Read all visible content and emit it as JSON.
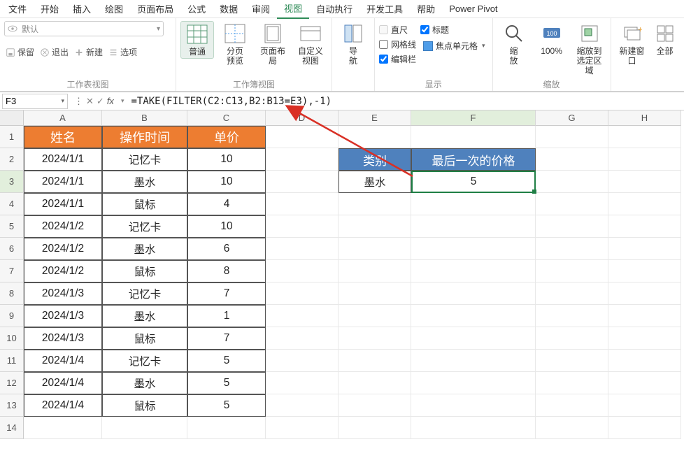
{
  "menu": {
    "items": [
      "文件",
      "开始",
      "插入",
      "绘图",
      "页面布局",
      "公式",
      "数据",
      "审阅",
      "视图",
      "自动执行",
      "开发工具",
      "帮助",
      "Power Pivot"
    ],
    "active_index": 8
  },
  "ribbon": {
    "worksheet_view": {
      "label": "工作表视图",
      "dropdown_text": "默认",
      "save": "保留",
      "exit": "退出",
      "new": "新建",
      "options": "选项"
    },
    "workbook_view": {
      "label": "工作簿视图",
      "normal": "普通",
      "page_break": "分页\n预览",
      "page_layout": "页面布局",
      "custom_view": "自定义视图"
    },
    "nav": {
      "label": "导\n航"
    },
    "display": {
      "label": "显示",
      "ruler": "直尺",
      "gridlines": "网格线",
      "formula_bar": "编辑栏",
      "headings": "标题",
      "focus_cell": "焦点单元格"
    },
    "zoom": {
      "label": "缩放",
      "zoom": "缩\n放",
      "hundred": "100%",
      "to_selection": "缩放到\n选定区域"
    },
    "window": {
      "new_window": "新建窗口",
      "arrange_all": "全部"
    }
  },
  "formula_bar": {
    "name_box": "F3",
    "fx_label": "fx",
    "formula": "=TAKE(FILTER(C2:C13,B2:B13=E3),-1)"
  },
  "grid": {
    "col_letters": [
      "A",
      "B",
      "C",
      "D",
      "E",
      "F",
      "G",
      "H"
    ],
    "row_numbers": [
      1,
      2,
      3,
      4,
      5,
      6,
      7,
      8,
      9,
      10,
      11,
      12,
      13,
      14
    ],
    "headers1": {
      "A": "姓名",
      "B": "操作时间",
      "C": "单价"
    },
    "headers2": {
      "E": "类别",
      "F": "最后一次的价格"
    },
    "data": [
      {
        "A": "2024/1/1",
        "B": "记忆卡",
        "C": "10"
      },
      {
        "A": "2024/1/1",
        "B": "墨水",
        "C": "10"
      },
      {
        "A": "2024/1/1",
        "B": "鼠标",
        "C": "4"
      },
      {
        "A": "2024/1/2",
        "B": "记忆卡",
        "C": "10"
      },
      {
        "A": "2024/1/2",
        "B": "墨水",
        "C": "6"
      },
      {
        "A": "2024/1/2",
        "B": "鼠标",
        "C": "8"
      },
      {
        "A": "2024/1/3",
        "B": "记忆卡",
        "C": "7"
      },
      {
        "A": "2024/1/3",
        "B": "墨水",
        "C": "1"
      },
      {
        "A": "2024/1/3",
        "B": "鼠标",
        "C": "7"
      },
      {
        "A": "2024/1/4",
        "B": "记忆卡",
        "C": "5"
      },
      {
        "A": "2024/1/4",
        "B": "墨水",
        "C": "5"
      },
      {
        "A": "2024/1/4",
        "B": "鼠标",
        "C": "5"
      }
    ],
    "side": {
      "E": "墨水",
      "F": "5"
    }
  }
}
